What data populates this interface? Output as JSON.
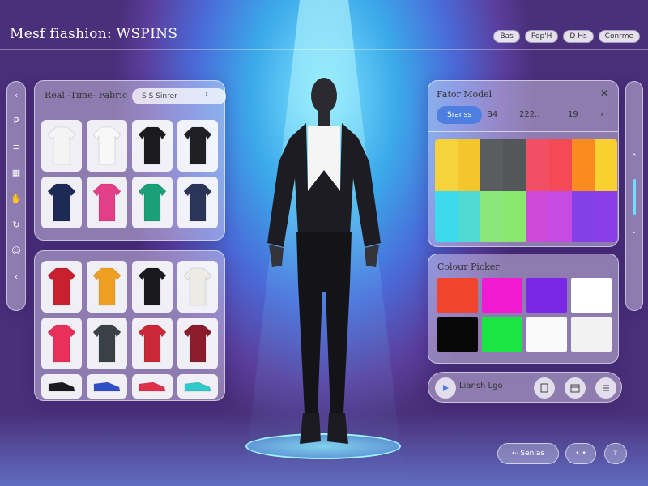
{
  "app": {
    "title": "Mesf fiashion: WSPINS"
  },
  "topbar": {
    "buttons": [
      "Bas",
      "Pop'H",
      "D Hs",
      "Conrme"
    ]
  },
  "fabric_panel": {
    "title": "Real -Time- Fabric",
    "search_label": "S S Sinrer",
    "items": [
      {
        "color": "#f4f4f4"
      },
      {
        "color": "#f8f8f8"
      },
      {
        "color": "#1b1b1f"
      },
      {
        "color": "#1f1f24"
      },
      {
        "color": "#1c2a55"
      },
      {
        "color": "#e33e87"
      },
      {
        "color": "#1aa078"
      },
      {
        "color": "#2b3558"
      }
    ]
  },
  "clothing_panel": {
    "items": [
      {
        "color": "#c8202e"
      },
      {
        "color": "#f0a020"
      },
      {
        "color": "#1a1a1e"
      },
      {
        "color": "#ecebe6"
      },
      {
        "color": "#e8305a"
      },
      {
        "color": "#3a4048"
      },
      {
        "color": "#c82838"
      },
      {
        "color": "#8a1c2c"
      },
      {
        "color": "#1a1a1e"
      },
      {
        "color": "#3050c8"
      },
      {
        "color": "#e0304a"
      },
      {
        "color": "#30c8c8"
      }
    ]
  },
  "model_panel": {
    "title": "Fator Model",
    "tab_active": "Sranss",
    "values": [
      "B4",
      "222..",
      "19"
    ],
    "palette": [
      "#f6d33a",
      "#f3c62e",
      "#5a5d60",
      "#53575a",
      "#f34f64",
      "#f34a55",
      "#fb8a1f",
      "#f8d130",
      "#3dd9ec",
      "#4fdbd4",
      "#8ae87a",
      "#88e96e",
      "#cf4ad8",
      "#c64be4",
      "#8240e6",
      "#8a3ee9"
    ]
  },
  "color_picker": {
    "title": "Colour Picker",
    "swatches": [
      "#f0442f",
      "#f01ad2",
      "#7a28e6",
      "#ffffff",
      "#080808",
      "#1be542",
      "#fafafa",
      "#f2f2f2"
    ]
  },
  "action_bar": {
    "label": "Liansh Lgo"
  },
  "bottom_buttons": {
    "settings": "Senlas"
  },
  "icons": {
    "left_rail": [
      "chevron-left-icon",
      "person-icon",
      "layers-icon",
      "grid-icon",
      "hand-icon",
      "refresh-icon",
      "avatar-icon",
      "chevron-left-icon"
    ]
  }
}
